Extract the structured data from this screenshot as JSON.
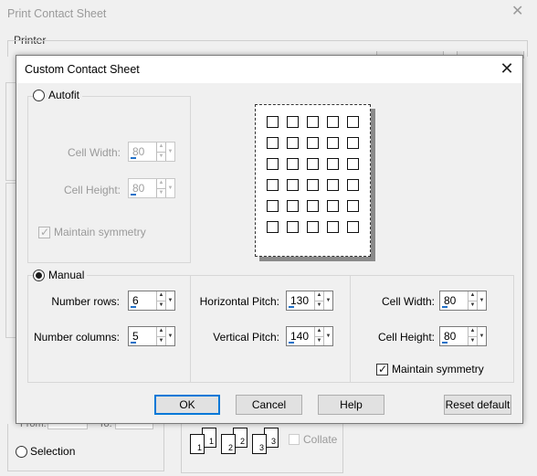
{
  "background_window": {
    "title": "Print Contact Sheet",
    "printer_group_label": "Printer",
    "from_label": "From:",
    "to_label": "To:",
    "selection_label": "Selection",
    "collate_label": "Collate",
    "page_numbers": [
      "1",
      "1",
      "2",
      "2",
      "3",
      "3"
    ]
  },
  "dialog": {
    "title": "Custom Contact Sheet",
    "autofit": {
      "label": "Autofit",
      "selected": false,
      "cell_width_label": "Cell Width:",
      "cell_width_value": "80",
      "cell_height_label": "Cell Height:",
      "cell_height_value": "80",
      "maintain_symmetry_label": "Maintain symmetry",
      "maintain_symmetry_checked": true
    },
    "manual": {
      "label": "Manual",
      "selected": true,
      "rows_label": "Number rows:",
      "rows_value": "6",
      "columns_label": "Number columns:",
      "columns_value": "5",
      "horizontal_pitch_label": "Horizontal Pitch:",
      "horizontal_pitch_value": "130",
      "vertical_pitch_label": "Vertical Pitch:",
      "vertical_pitch_value": "140",
      "cell_width_label": "Cell Width:",
      "cell_width_value": "80",
      "cell_height_label": "Cell Height:",
      "cell_height_value": "80",
      "maintain_symmetry_label": "Maintain symmetry",
      "maintain_symmetry_checked": true
    },
    "preview": {
      "rows": 6,
      "columns": 5
    },
    "buttons": {
      "ok": "OK",
      "cancel": "Cancel",
      "help": "Help",
      "reset": "Reset default"
    }
  },
  "colors": {
    "accent": "#0078d7",
    "spin_indicator": "#2372c9",
    "background": "#f0f0f0"
  }
}
